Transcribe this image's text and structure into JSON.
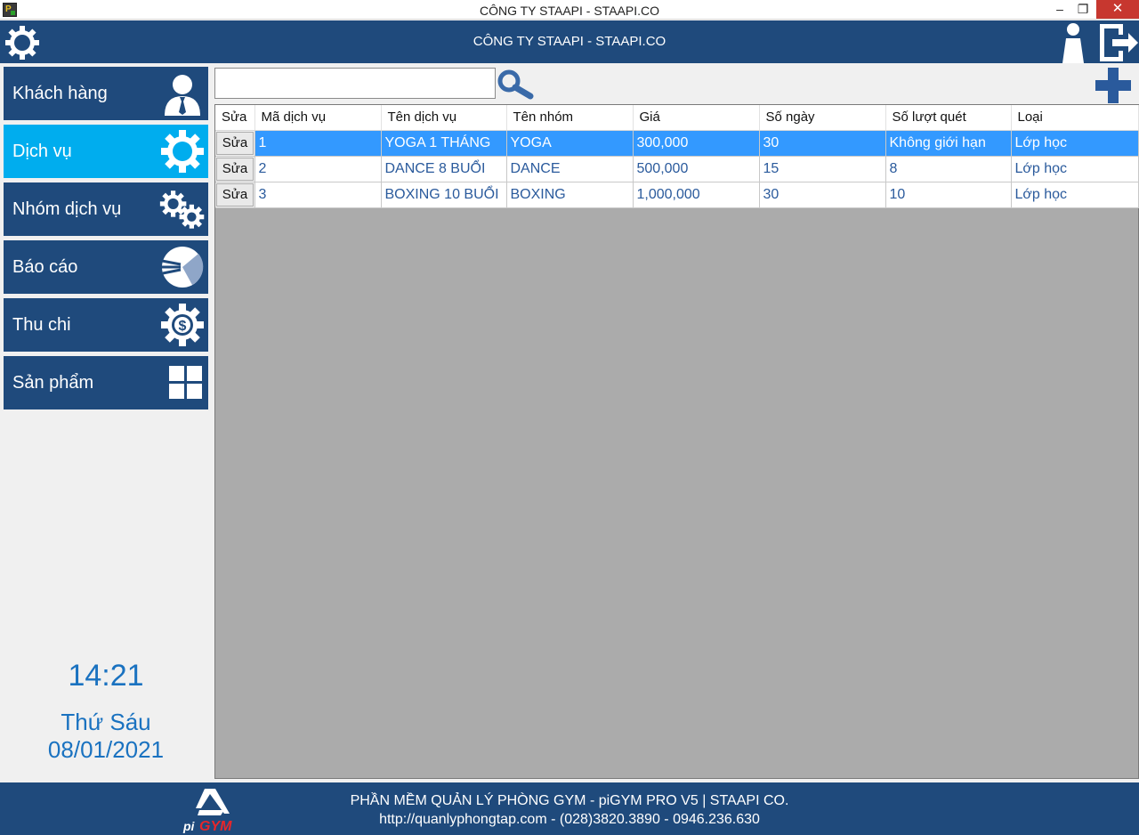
{
  "window": {
    "title": "CÔNG TY STAAPI - STAAPI.CO",
    "min_glyph": "–",
    "max_glyph": "❐",
    "close_glyph": "✕",
    "app_icon_letter": "P"
  },
  "header": {
    "title": "CÔNG TY STAAPI - STAAPI.CO"
  },
  "sidebar": {
    "items": [
      {
        "label": "Khách hàng",
        "icon": "customer-icon"
      },
      {
        "label": "Dịch vụ",
        "icon": "gear-icon",
        "active": true
      },
      {
        "label": "Nhóm dịch vụ",
        "icon": "gears-icon"
      },
      {
        "label": "Báo cáo",
        "icon": "pie-chart-icon"
      },
      {
        "label": "Thu chi",
        "icon": "money-gear-icon"
      },
      {
        "label": "Sản phẩm",
        "icon": "grid-icon"
      }
    ]
  },
  "clock": {
    "time": "14:21",
    "day": "Thứ Sáu",
    "date": "08/01/2021"
  },
  "search": {
    "value": "",
    "placeholder": ""
  },
  "table": {
    "columns": [
      "Sửa",
      "Mã dịch vụ",
      "Tên dịch vụ",
      "Tên nhóm",
      "Giá",
      "Số ngày",
      "Số lượt quét",
      "Loại"
    ],
    "edit_label": "Sửa",
    "rows": [
      {
        "ma": "1",
        "ten": "YOGA 1 THÁNG",
        "nhom": "YOGA",
        "gia": "300,000",
        "so_ngay": "30",
        "so_luot": "Không giới hạn",
        "loai": "Lớp học",
        "selected": true
      },
      {
        "ma": "2",
        "ten": "DANCE 8 BUỔI",
        "nhom": "DANCE",
        "gia": "500,000",
        "so_ngay": "15",
        "so_luot": "8",
        "loai": "Lớp học"
      },
      {
        "ma": "3",
        "ten": "BOXING 10 BUỔI",
        "nhom": "BOXING",
        "gia": "1,000,000",
        "so_ngay": "30",
        "so_luot": "10",
        "loai": "Lớp học"
      }
    ]
  },
  "footer": {
    "line1": "PHẦN MỀM QUẢN LÝ PHÒNG GYM - piGYM PRO V5 | STAAPI CO.",
    "line2": "http://quanlyphongtap.com - (028)3820.3890 - 0946.236.630",
    "logo_text_pi": "pi",
    "logo_text_gym": "GYM"
  },
  "colors": {
    "nav": "#1f4a7c",
    "nav_active": "#00adee",
    "selected_row": "#3399ff",
    "clock": "#1a72c0"
  }
}
